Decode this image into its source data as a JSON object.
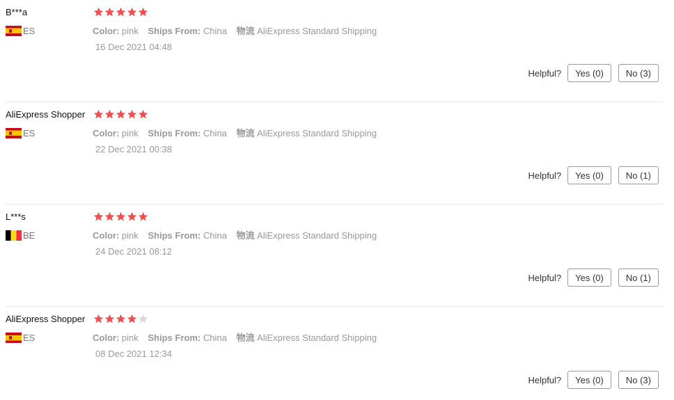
{
  "labels": {
    "color_key": "Color:",
    "ships_key": "Ships From:",
    "logistics_key": "物流",
    "helpful": "Helpful?"
  },
  "star_colors": {
    "filled": "#f04e4e",
    "empty": "#d9d9d9"
  },
  "reviews": [
    {
      "user": "B***a",
      "country": "ES",
      "flag_icon": "spain-flag-icon",
      "rating": 5,
      "color": "pink",
      "ships_from": "China",
      "logistics": "AliExpress Standard Shipping",
      "date": "16 Dec 2021 04:48",
      "yes": "Yes (0)",
      "no": "No (3)"
    },
    {
      "user": "AliExpress Shopper",
      "country": "ES",
      "flag_icon": "spain-flag-icon",
      "rating": 5,
      "color": "pink",
      "ships_from": "China",
      "logistics": "AliExpress Standard Shipping",
      "date": "22 Dec 2021 00:38",
      "yes": "Yes (0)",
      "no": "No (1)"
    },
    {
      "user": "L***s",
      "country": "BE",
      "flag_icon": "belgium-flag-icon",
      "rating": 5,
      "color": "pink",
      "ships_from": "China",
      "logistics": "AliExpress Standard Shipping",
      "date": "24 Dec 2021 08:12",
      "yes": "Yes (0)",
      "no": "No (1)"
    },
    {
      "user": "AliExpress Shopper",
      "country": "ES",
      "flag_icon": "spain-flag-icon",
      "rating": 4,
      "color": "pink",
      "ships_from": "China",
      "logistics": "AliExpress Standard Shipping",
      "date": "08 Dec 2021 12:34",
      "yes": "Yes (0)",
      "no": "No (3)"
    }
  ]
}
